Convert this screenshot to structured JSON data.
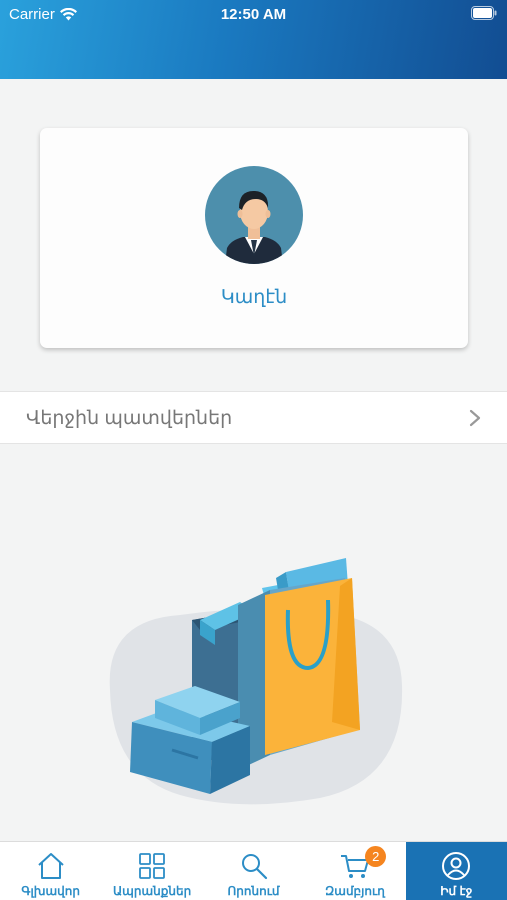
{
  "status_bar": {
    "carrier": "Carrier",
    "time": "12:50 AM"
  },
  "profile": {
    "name": "Կաղէն"
  },
  "orders": {
    "label": "Վերջին պատվերներ"
  },
  "tabs": [
    {
      "label": "Գլխավոր",
      "icon": "home-icon"
    },
    {
      "label": "Ապրանքներ",
      "icon": "grid-icon"
    },
    {
      "label": "Որոնում",
      "icon": "search-icon"
    },
    {
      "label": "Զամբյուղ",
      "icon": "cart-icon",
      "badge": "2"
    },
    {
      "label": "Իմ էջ",
      "icon": "user-icon",
      "active": true
    }
  ],
  "colors": {
    "header_start": "#2aa1dc",
    "header_end": "#124d92",
    "accent": "#2c8dc6",
    "active_tab": "#1a72b4",
    "badge": "#f5851f"
  }
}
